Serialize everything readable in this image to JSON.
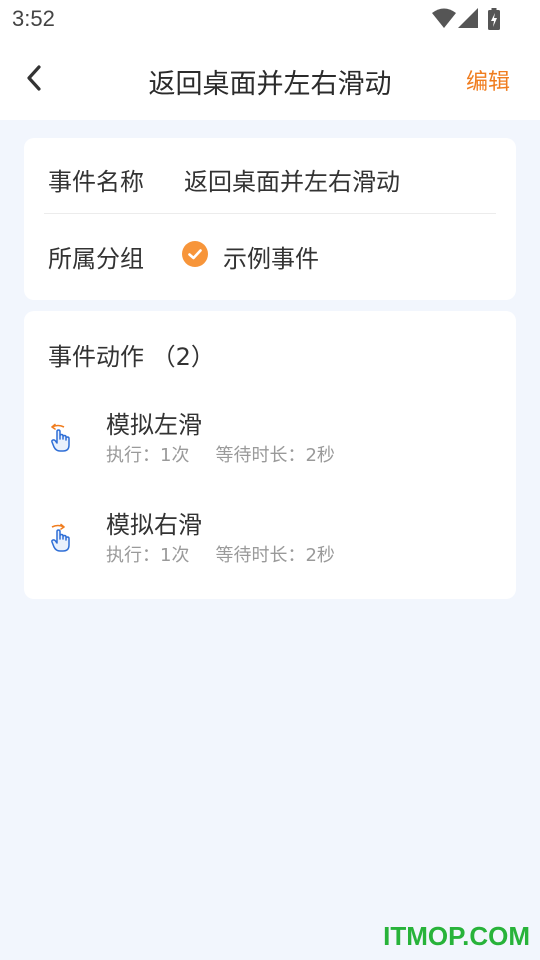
{
  "status_bar": {
    "time": "3:52",
    "icons": [
      "wifi-icon",
      "signal-icon",
      "battery-icon"
    ]
  },
  "header": {
    "title": "返回桌面并左右滑动",
    "edit_label": "编辑",
    "back_icon": "chevron-left-icon"
  },
  "info_card": {
    "name_label": "事件名称",
    "name_value": "返回桌面并左右滑动",
    "group_label": "所属分组",
    "group_value": "示例事件"
  },
  "actions_card": {
    "title": "事件动作 （2）",
    "items": [
      {
        "name": "模拟左滑",
        "exec_text": "执行：1次",
        "wait_text": "等待时长：2秒",
        "icon": "swipe-left-hand-icon"
      },
      {
        "name": "模拟右滑",
        "exec_text": "执行：1次",
        "wait_text": "等待时长：2秒",
        "icon": "swipe-right-hand-icon"
      }
    ]
  },
  "watermark": "ITMOP.COM",
  "colors": {
    "accent": "#f07d1f",
    "check": "#f7953a",
    "background": "#f2f6fd",
    "icon_blue": "#2f6fd6"
  }
}
